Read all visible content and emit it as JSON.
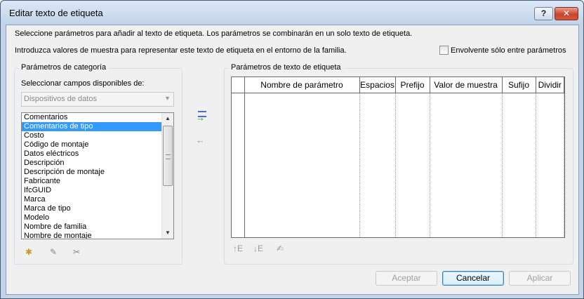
{
  "window": {
    "title": "Editar texto de etiqueta",
    "help_label": "?",
    "close_label": "✕"
  },
  "instructions": {
    "line1": "Seleccione parámetros para añadir al texto de etiqueta. Los parámetros se combinarán en un solo texto de etiqueta.",
    "line2": "Introduzca valores de muestra para representar este texto de etiqueta en el entorno de la familia."
  },
  "wrap_checkbox": {
    "label": "Envolvente sólo entre parámetros",
    "checked": false
  },
  "category_params": {
    "legend": "Parámetros de categoría",
    "select_label": "Seleccionar campos disponibles de:",
    "combo_value": "Dispositivos de datos",
    "items": [
      "Comentarios",
      "Comentarios de tipo",
      "Costo",
      "Código de montaje",
      "Datos eléctricos",
      "Descripción",
      "Descripción de montaje",
      "Fabricante",
      "IfcGUID",
      "Marca",
      "Marca de tipo",
      "Modelo",
      "Nombre de familia",
      "Nombre de montaje"
    ],
    "selected_index": 1
  },
  "label_params": {
    "legend": "Parámetros de texto de etiqueta",
    "columns": [
      "Nombre de parámetro",
      "Espacios",
      "Prefijo",
      "Valor de muestra",
      "Sufijo",
      "Dividir"
    ]
  },
  "icons": {
    "add_param": "add-parameter-icon",
    "remove_param": "remove-parameter-icon",
    "new_param": "new-parameter-icon",
    "edit_param": "edit-parameter-icon",
    "delete_param": "delete-parameter-icon",
    "move_up": "move-up-icon",
    "move_down": "move-down-icon",
    "format": "format-icon"
  },
  "buttons": {
    "ok": "Aceptar",
    "cancel": "Cancelar",
    "apply": "Aplicar"
  },
  "colors": {
    "selection": "#3399ff",
    "titlebar": "#c2d4ea",
    "dialog_bg": "#f0f0f0"
  }
}
